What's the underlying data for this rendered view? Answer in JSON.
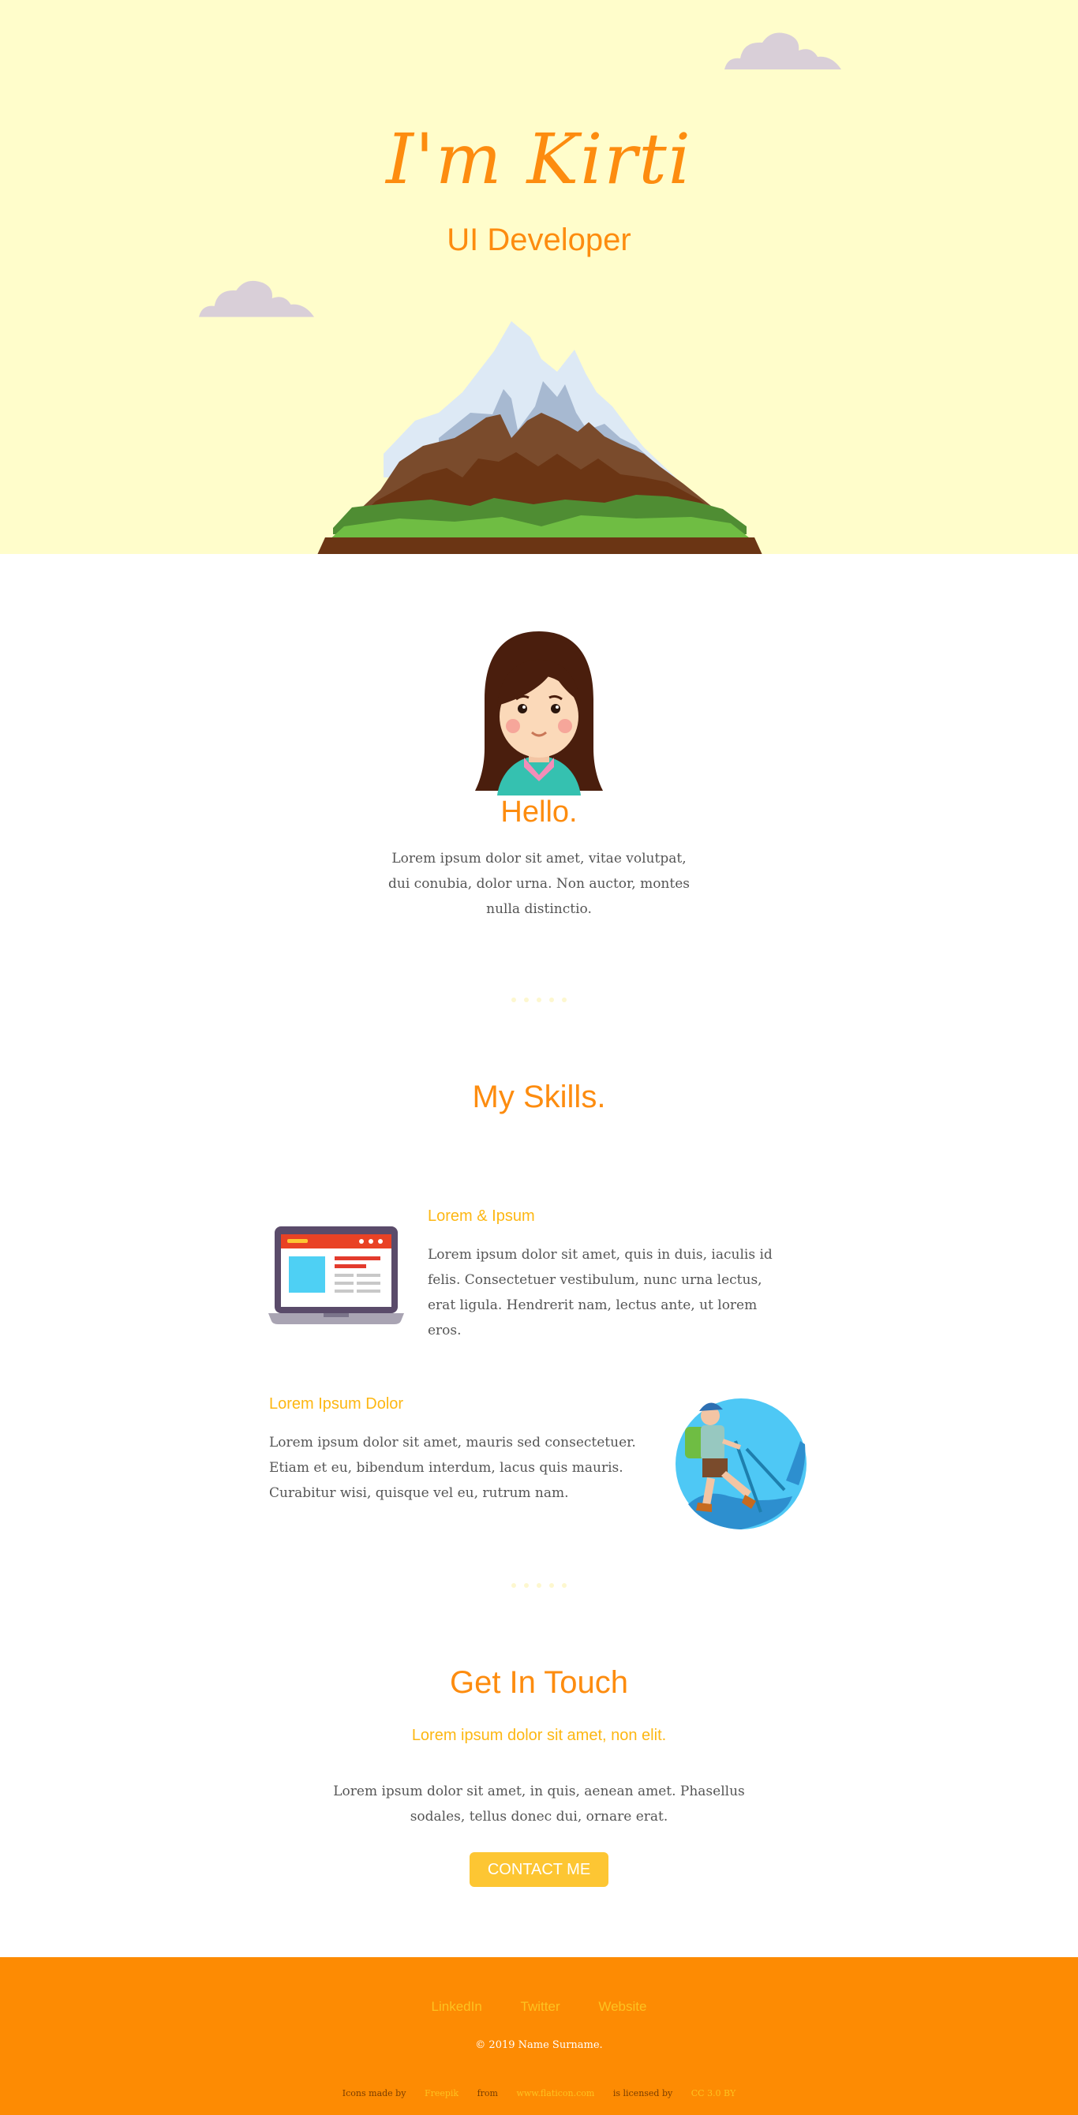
{
  "hero": {
    "title": "I'm Kirti",
    "subtitle": "UI Developer",
    "background_color": "#fffdcb",
    "accent_color": "#fd8c0f"
  },
  "about": {
    "heading": "Hello.",
    "text": "Lorem ipsum dolor sit amet, vitae volutpat, dui conubia, dolor urna. Non auctor, montes nulla distinctio."
  },
  "skills": {
    "heading": "My Skills.",
    "items": [
      {
        "title": "Lorem & Ipsum",
        "text": "Lorem ipsum dolor sit amet, quis in duis, iaculis id felis. Consectetuer vestibulum, nunc urna lectus, erat ligula. Hendrerit nam, lectus ante, ut lorem eros.",
        "icon": "laptop-icon"
      },
      {
        "title": "Lorem Ipsum Dolor",
        "text": "Lorem ipsum dolor sit amet, mauris sed consectetuer. Etiam et eu, bibendum interdum, lacus quis mauris. Curabitur wisi, quisque vel eu, rutrum nam.",
        "icon": "hiker-icon"
      }
    ]
  },
  "contact": {
    "heading": "Get In Touch",
    "subheading": "Lorem ipsum dolor sit amet, non elit.",
    "text": "Lorem ipsum dolor sit amet, in quis, aenean amet. Phasellus sodales, tellus donec dui, ornare erat.",
    "button_label": "CONTACT ME",
    "button_color": "#fdc633"
  },
  "footer": {
    "links": [
      "LinkedIn",
      "Twitter",
      "Website"
    ],
    "copyright": "© 2019 Name Surname.",
    "credits": {
      "icons_made_by": "Icons made by",
      "author": "Freepik",
      "from": "from",
      "site": "www.flaticon.com",
      "licensed_by": "is licensed by",
      "license": "CC 3.0 BY"
    },
    "background_color": "#fd8b03"
  }
}
